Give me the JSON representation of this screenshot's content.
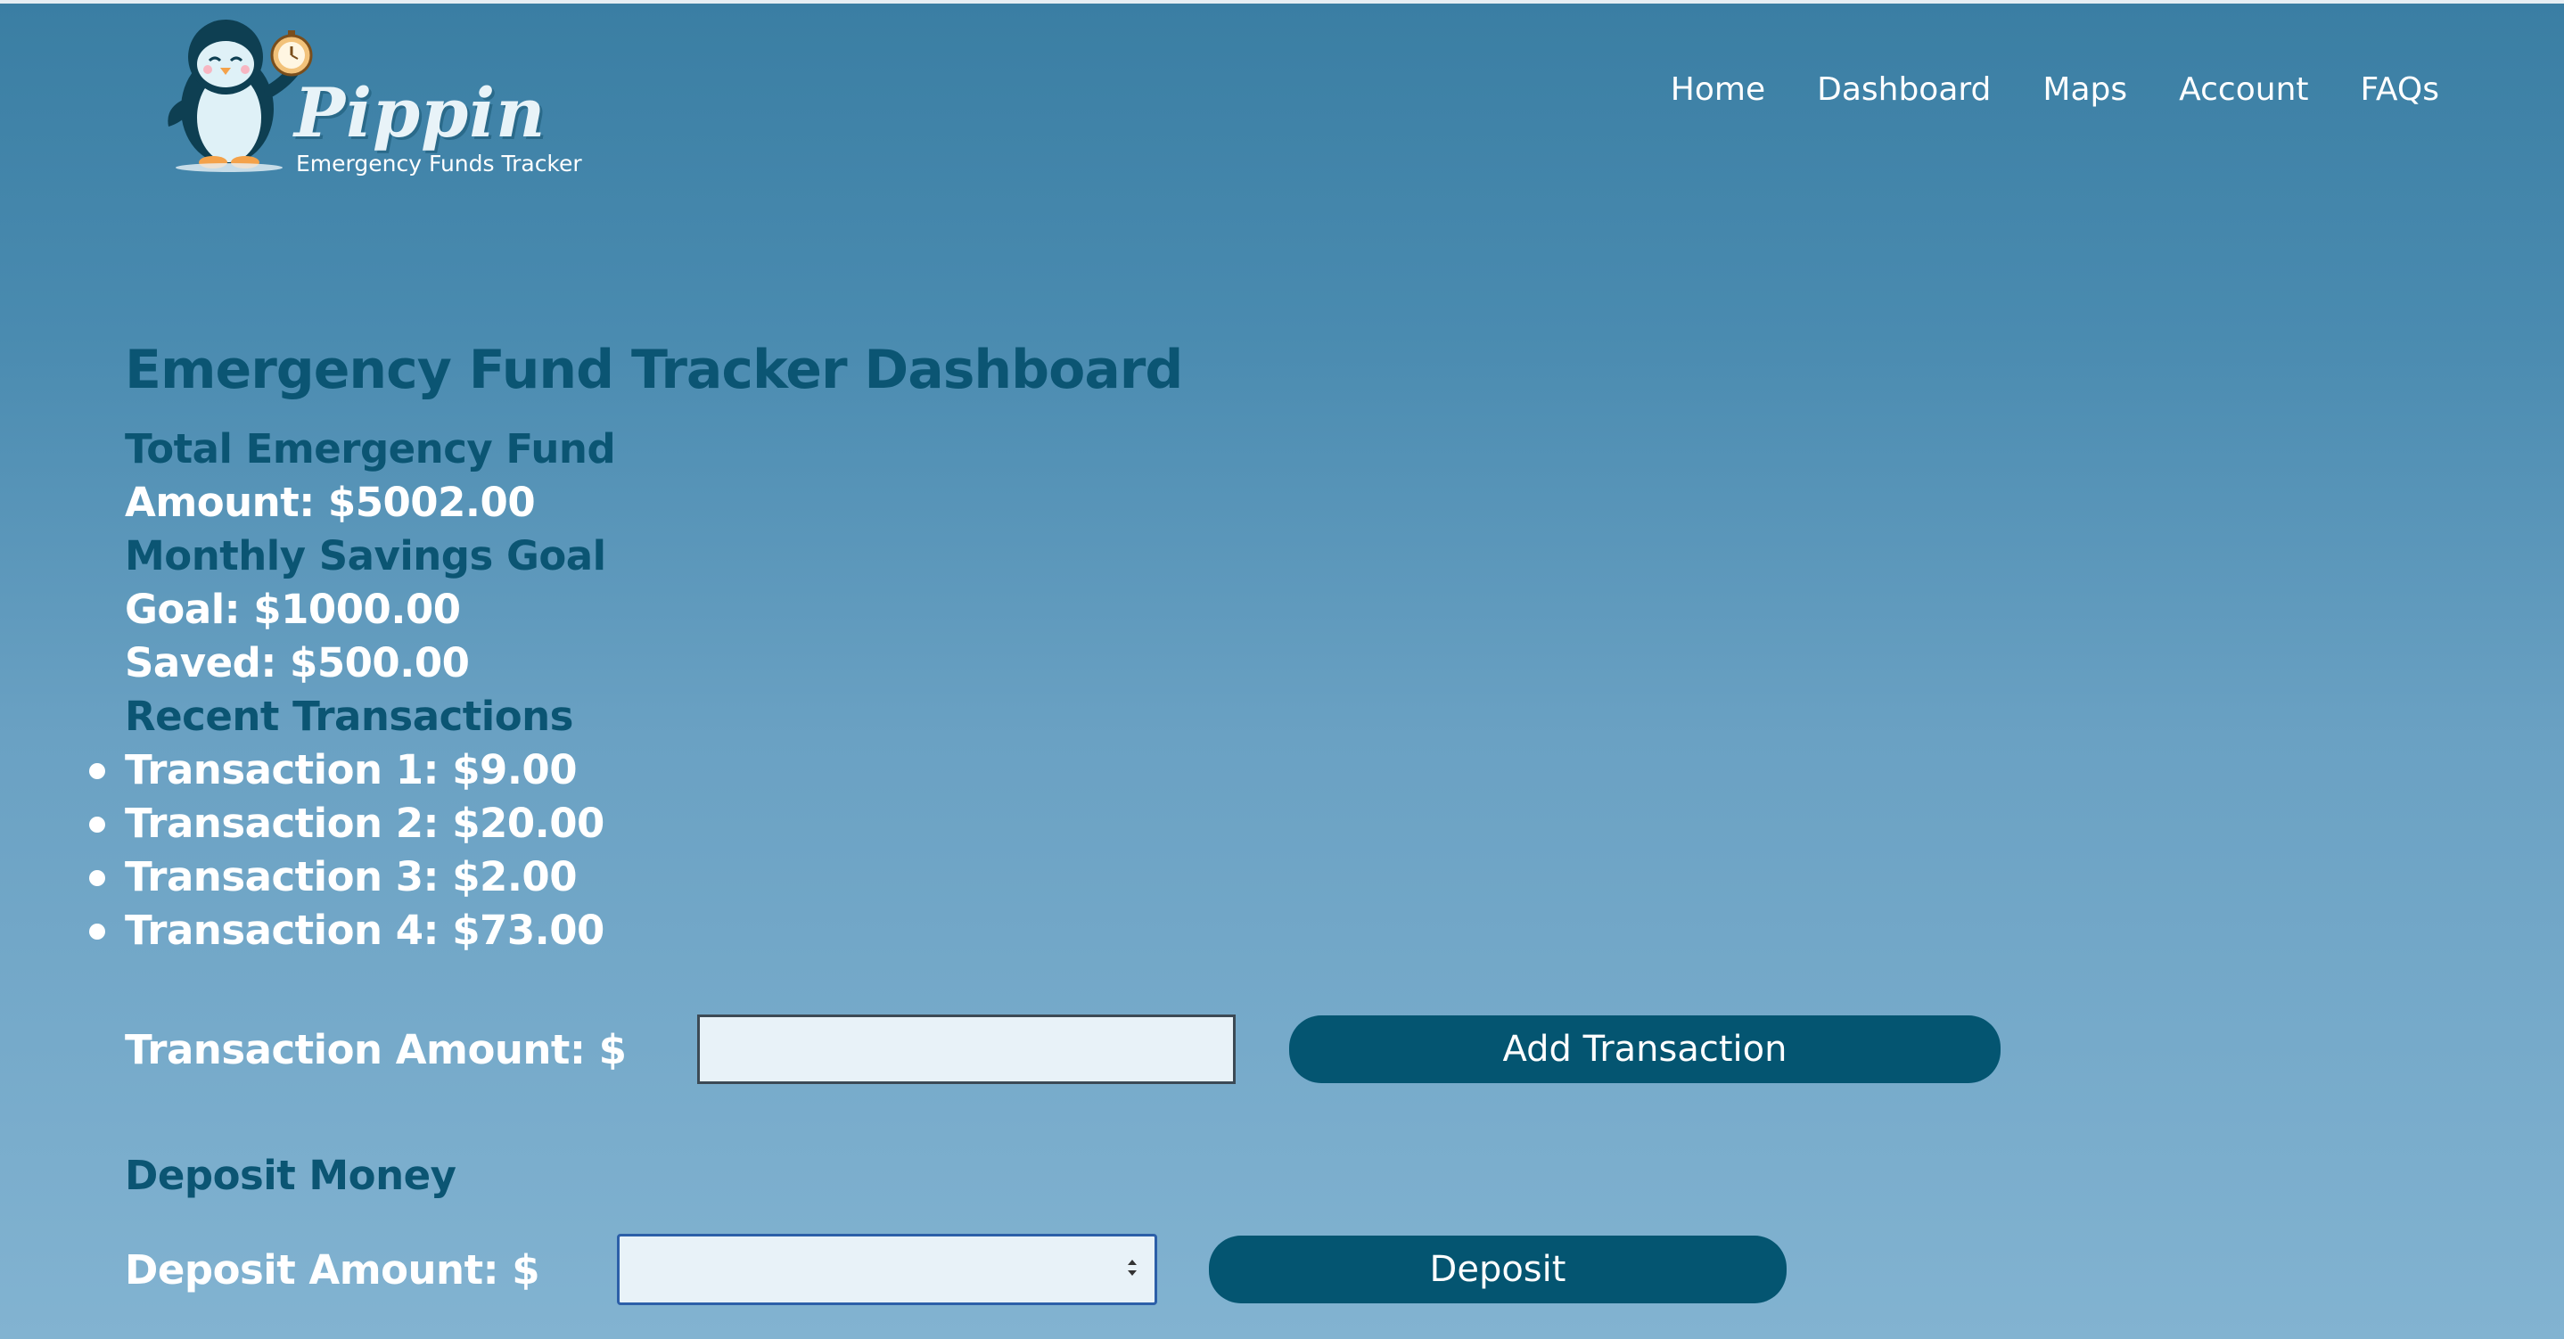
{
  "brand": {
    "name": "Pippin",
    "tagline": "Emergency Funds Tracker"
  },
  "nav": {
    "items": [
      "Home",
      "Dashboard",
      "Maps",
      "Account",
      "FAQs"
    ]
  },
  "dashboard": {
    "title": "Emergency Fund Tracker Dashboard",
    "total_heading": "Total Emergency Fund",
    "amount_line": "Amount: $5002.00",
    "goal_heading": "Monthly Savings Goal",
    "goal_line": "Goal: $1000.00",
    "saved_line": "Saved: $500.00",
    "recent_heading": "Recent Transactions",
    "transactions": [
      "Transaction 1: $9.00",
      "Transaction 2: $20.00",
      "Transaction 3: $2.00",
      "Transaction 4: $73.00"
    ]
  },
  "transaction_form": {
    "label": "Transaction Amount: $",
    "value": "",
    "button": "Add Transaction"
  },
  "deposit_form": {
    "heading": "Deposit Money",
    "label": "Deposit Amount: $",
    "value": "",
    "button": "Deposit"
  },
  "colors": {
    "primary_dark": "#045571",
    "heading": "#0b5573",
    "text_light": "#ffffff",
    "input_bg": "#e8f2f8"
  }
}
